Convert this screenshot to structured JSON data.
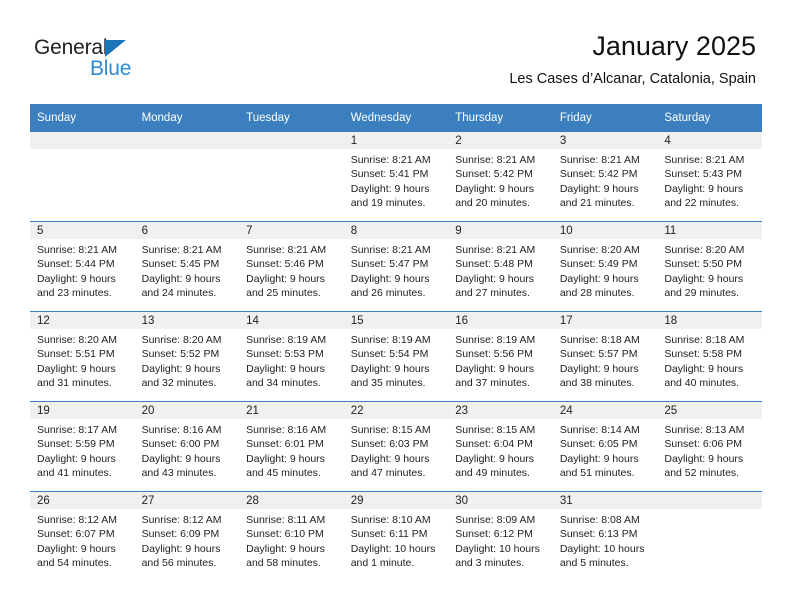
{
  "brand": {
    "name_part1": "General",
    "name_part2": "Blue",
    "triangle_color": "#1b75bb",
    "blue_text_color": "#2e8bd4"
  },
  "header": {
    "title": "January 2025",
    "subtitle": "Les Cases d’Alcanar, Catalonia, Spain"
  },
  "theme": {
    "header_blue": "#3b7fbf",
    "daynum_band": "#f0f0f0"
  },
  "weekday_headers": [
    "Sunday",
    "Monday",
    "Tuesday",
    "Wednesday",
    "Thursday",
    "Friday",
    "Saturday"
  ],
  "weeks": [
    [
      {
        "day": "",
        "empty": true,
        "lines": []
      },
      {
        "day": "",
        "empty": true,
        "lines": []
      },
      {
        "day": "",
        "empty": true,
        "lines": []
      },
      {
        "day": "1",
        "empty": false,
        "lines": [
          "Sunrise: 8:21 AM",
          "Sunset: 5:41 PM",
          "Daylight: 9 hours",
          "and 19 minutes."
        ]
      },
      {
        "day": "2",
        "empty": false,
        "lines": [
          "Sunrise: 8:21 AM",
          "Sunset: 5:42 PM",
          "Daylight: 9 hours",
          "and 20 minutes."
        ]
      },
      {
        "day": "3",
        "empty": false,
        "lines": [
          "Sunrise: 8:21 AM",
          "Sunset: 5:42 PM",
          "Daylight: 9 hours",
          "and 21 minutes."
        ]
      },
      {
        "day": "4",
        "empty": false,
        "lines": [
          "Sunrise: 8:21 AM",
          "Sunset: 5:43 PM",
          "Daylight: 9 hours",
          "and 22 minutes."
        ]
      }
    ],
    [
      {
        "day": "5",
        "empty": false,
        "lines": [
          "Sunrise: 8:21 AM",
          "Sunset: 5:44 PM",
          "Daylight: 9 hours",
          "and 23 minutes."
        ]
      },
      {
        "day": "6",
        "empty": false,
        "lines": [
          "Sunrise: 8:21 AM",
          "Sunset: 5:45 PM",
          "Daylight: 9 hours",
          "and 24 minutes."
        ]
      },
      {
        "day": "7",
        "empty": false,
        "lines": [
          "Sunrise: 8:21 AM",
          "Sunset: 5:46 PM",
          "Daylight: 9 hours",
          "and 25 minutes."
        ]
      },
      {
        "day": "8",
        "empty": false,
        "lines": [
          "Sunrise: 8:21 AM",
          "Sunset: 5:47 PM",
          "Daylight: 9 hours",
          "and 26 minutes."
        ]
      },
      {
        "day": "9",
        "empty": false,
        "lines": [
          "Sunrise: 8:21 AM",
          "Sunset: 5:48 PM",
          "Daylight: 9 hours",
          "and 27 minutes."
        ]
      },
      {
        "day": "10",
        "empty": false,
        "lines": [
          "Sunrise: 8:20 AM",
          "Sunset: 5:49 PM",
          "Daylight: 9 hours",
          "and 28 minutes."
        ]
      },
      {
        "day": "11",
        "empty": false,
        "lines": [
          "Sunrise: 8:20 AM",
          "Sunset: 5:50 PM",
          "Daylight: 9 hours",
          "and 29 minutes."
        ]
      }
    ],
    [
      {
        "day": "12",
        "empty": false,
        "lines": [
          "Sunrise: 8:20 AM",
          "Sunset: 5:51 PM",
          "Daylight: 9 hours",
          "and 31 minutes."
        ]
      },
      {
        "day": "13",
        "empty": false,
        "lines": [
          "Sunrise: 8:20 AM",
          "Sunset: 5:52 PM",
          "Daylight: 9 hours",
          "and 32 minutes."
        ]
      },
      {
        "day": "14",
        "empty": false,
        "lines": [
          "Sunrise: 8:19 AM",
          "Sunset: 5:53 PM",
          "Daylight: 9 hours",
          "and 34 minutes."
        ]
      },
      {
        "day": "15",
        "empty": false,
        "lines": [
          "Sunrise: 8:19 AM",
          "Sunset: 5:54 PM",
          "Daylight: 9 hours",
          "and 35 minutes."
        ]
      },
      {
        "day": "16",
        "empty": false,
        "lines": [
          "Sunrise: 8:19 AM",
          "Sunset: 5:56 PM",
          "Daylight: 9 hours",
          "and 37 minutes."
        ]
      },
      {
        "day": "17",
        "empty": false,
        "lines": [
          "Sunrise: 8:18 AM",
          "Sunset: 5:57 PM",
          "Daylight: 9 hours",
          "and 38 minutes."
        ]
      },
      {
        "day": "18",
        "empty": false,
        "lines": [
          "Sunrise: 8:18 AM",
          "Sunset: 5:58 PM",
          "Daylight: 9 hours",
          "and 40 minutes."
        ]
      }
    ],
    [
      {
        "day": "19",
        "empty": false,
        "lines": [
          "Sunrise: 8:17 AM",
          "Sunset: 5:59 PM",
          "Daylight: 9 hours",
          "and 41 minutes."
        ]
      },
      {
        "day": "20",
        "empty": false,
        "lines": [
          "Sunrise: 8:16 AM",
          "Sunset: 6:00 PM",
          "Daylight: 9 hours",
          "and 43 minutes."
        ]
      },
      {
        "day": "21",
        "empty": false,
        "lines": [
          "Sunrise: 8:16 AM",
          "Sunset: 6:01 PM",
          "Daylight: 9 hours",
          "and 45 minutes."
        ]
      },
      {
        "day": "22",
        "empty": false,
        "lines": [
          "Sunrise: 8:15 AM",
          "Sunset: 6:03 PM",
          "Daylight: 9 hours",
          "and 47 minutes."
        ]
      },
      {
        "day": "23",
        "empty": false,
        "lines": [
          "Sunrise: 8:15 AM",
          "Sunset: 6:04 PM",
          "Daylight: 9 hours",
          "and 49 minutes."
        ]
      },
      {
        "day": "24",
        "empty": false,
        "lines": [
          "Sunrise: 8:14 AM",
          "Sunset: 6:05 PM",
          "Daylight: 9 hours",
          "and 51 minutes."
        ]
      },
      {
        "day": "25",
        "empty": false,
        "lines": [
          "Sunrise: 8:13 AM",
          "Sunset: 6:06 PM",
          "Daylight: 9 hours",
          "and 52 minutes."
        ]
      }
    ],
    [
      {
        "day": "26",
        "empty": false,
        "lines": [
          "Sunrise: 8:12 AM",
          "Sunset: 6:07 PM",
          "Daylight: 9 hours",
          "and 54 minutes."
        ]
      },
      {
        "day": "27",
        "empty": false,
        "lines": [
          "Sunrise: 8:12 AM",
          "Sunset: 6:09 PM",
          "Daylight: 9 hours",
          "and 56 minutes."
        ]
      },
      {
        "day": "28",
        "empty": false,
        "lines": [
          "Sunrise: 8:11 AM",
          "Sunset: 6:10 PM",
          "Daylight: 9 hours",
          "and 58 minutes."
        ]
      },
      {
        "day": "29",
        "empty": false,
        "lines": [
          "Sunrise: 8:10 AM",
          "Sunset: 6:11 PM",
          "Daylight: 10 hours",
          "and 1 minute."
        ]
      },
      {
        "day": "30",
        "empty": false,
        "lines": [
          "Sunrise: 8:09 AM",
          "Sunset: 6:12 PM",
          "Daylight: 10 hours",
          "and 3 minutes."
        ]
      },
      {
        "day": "31",
        "empty": false,
        "lines": [
          "Sunrise: 8:08 AM",
          "Sunset: 6:13 PM",
          "Daylight: 10 hours",
          "and 5 minutes."
        ]
      },
      {
        "day": "",
        "empty": true,
        "lines": []
      }
    ]
  ]
}
